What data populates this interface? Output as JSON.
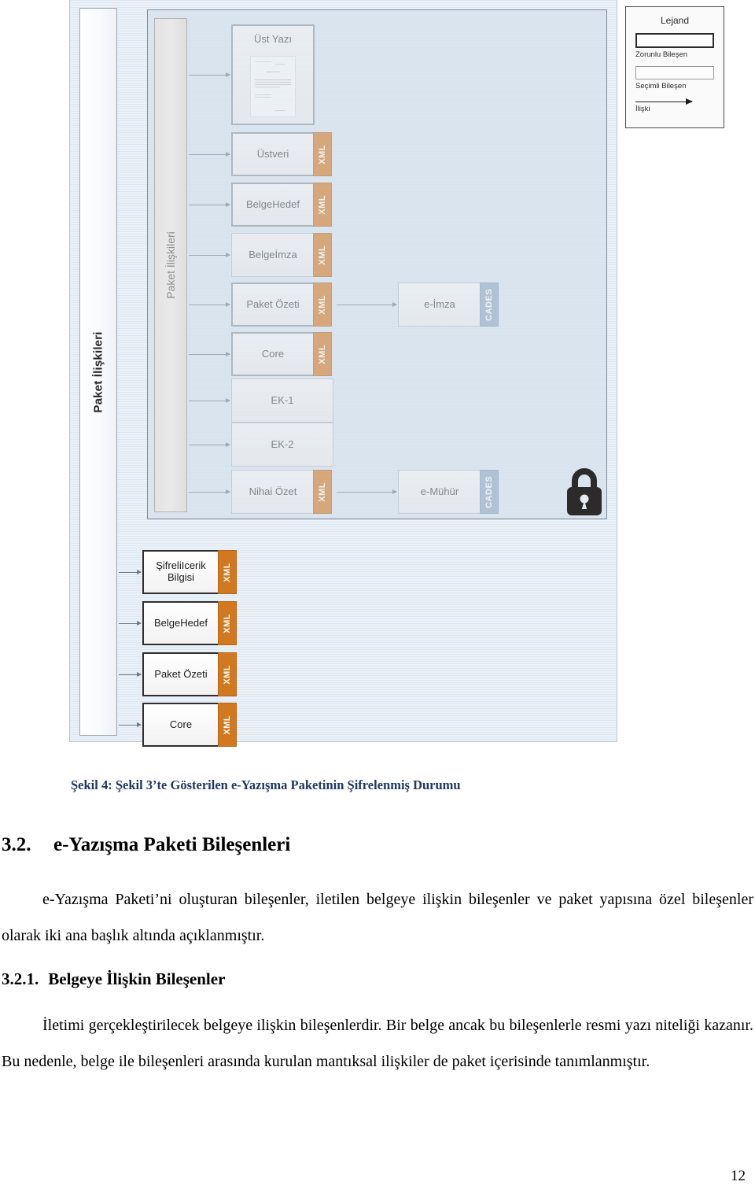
{
  "figure": {
    "outer_band_label": "Paket İlişkileri",
    "inner_band_label": "Paket İlişkileri",
    "padlock_icon": "lock-icon",
    "encrypted_nodes": [
      {
        "label": "Üst Yazı",
        "tag": "",
        "border": "thick",
        "has_preview": true
      },
      {
        "label": "Üstveri",
        "tag": "XML",
        "border": "thick",
        "has_preview": false
      },
      {
        "label": "BelgeHedef",
        "tag": "XML",
        "border": "thick",
        "has_preview": false
      },
      {
        "label": "Belgeİmza",
        "tag": "XML",
        "border": "thin",
        "has_preview": false
      },
      {
        "label": "Paket Özeti",
        "tag": "XML",
        "border": "thick",
        "has_preview": false
      },
      {
        "label": "Core",
        "tag": "XML",
        "border": "thick",
        "has_preview": false
      },
      {
        "label": "EK-1",
        "tag": "",
        "border": "thin",
        "has_preview": false
      },
      {
        "label": "EK-2",
        "tag": "",
        "border": "thin",
        "has_preview": false
      },
      {
        "label": "Nihai Özet",
        "tag": "XML",
        "border": "thin",
        "has_preview": false
      }
    ],
    "signature_nodes": [
      {
        "label": "e-İmza",
        "tag": "CADES",
        "border": "thin"
      },
      {
        "label": "e-Mühür",
        "tag": "CADES",
        "border": "thin"
      }
    ],
    "outer_nodes": [
      {
        "label": "ŞifreliIcerik Bilgisi",
        "tag": "XML",
        "border": "thick"
      },
      {
        "label": "BelgeHedef",
        "tag": "XML",
        "border": "thick"
      },
      {
        "label": "Paket Özeti",
        "tag": "XML",
        "border": "thick"
      },
      {
        "label": "Core",
        "tag": "XML",
        "border": "thick"
      }
    ],
    "legend": {
      "title": "Lejand",
      "mandatory_label": "Zorunlu Bileşen",
      "optional_label": "Seçimli Bileşen",
      "relation_label": "İlişki"
    },
    "colors": {
      "xml_tag": "#d2781f",
      "cades_tag": "#8fa7c0",
      "canvas": "#eaf1f8",
      "caption": "#1f3864"
    }
  },
  "document": {
    "figure_caption": "Şekil 4: Şekil 3’te Gösterilen e-Yazışma Paketinin Şifrelenmiş Durumu",
    "heading_32_number": "3.2.",
    "heading_32_title": "e-Yazışma Paketi Bileşenleri",
    "paragraph_1": "e-Yazışma Paketi’ni oluşturan bileşenler, iletilen belgeye ilişkin bileşenler ve paket yapısına özel bileşenler olarak iki ana başlık altında açıklanmıştır.",
    "heading_321_number": "3.2.1.",
    "heading_321_title": "Belgeye İlişkin Bileşenler",
    "paragraph_2": "İletimi gerçekleştirilecek belgeye ilişkin bileşenlerdir. Bir belge ancak bu bileşenlerle resmi yazı niteliği kazanır. Bu nedenle, belge ile bileşenleri arasında kurulan mantıksal ilişkiler de paket içerisinde tanımlanmıştır.",
    "page_number": "12"
  }
}
